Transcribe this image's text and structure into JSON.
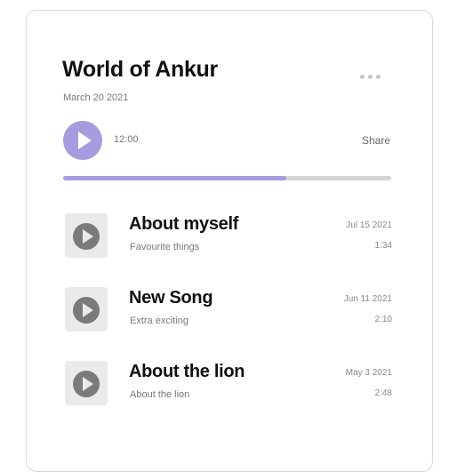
{
  "header": {
    "title": "World of Ankur",
    "date": "March 20 2021",
    "more_icon": "more-horizontal-icon"
  },
  "player": {
    "play_icon": "play-icon",
    "time": "12:00",
    "share_label": "Share",
    "progress_percent": 68,
    "accent_color": "#a79be0"
  },
  "tracks": [
    {
      "title": "About myself",
      "subtitle": "Favourite things",
      "date": "Jul 15 2021",
      "duration": "1:34"
    },
    {
      "title": "New Song",
      "subtitle": "Extra exciting",
      "date": "Jun 11 2021",
      "duration": "2:10"
    },
    {
      "title": "About the lion",
      "subtitle": "About the lion",
      "date": "May 3 2021",
      "duration": "2:48"
    }
  ]
}
